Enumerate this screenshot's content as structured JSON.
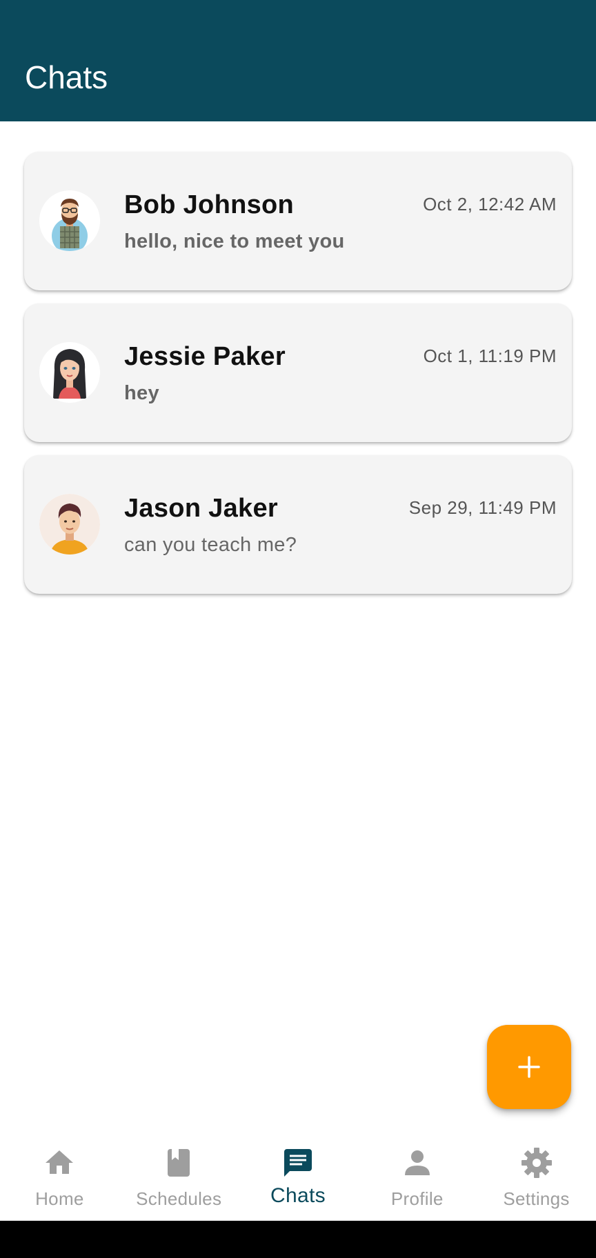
{
  "app_bar": {
    "title": "Chats"
  },
  "chats": [
    {
      "name": "Bob Johnson",
      "time": "Oct 2, 12:42 AM",
      "message": "hello, nice to meet you",
      "avatar_icon": "bearded-man-avatar"
    },
    {
      "name": "Jessie Paker",
      "time": "Oct 1, 11:19 PM",
      "message": "hey",
      "avatar_icon": "woman-avatar"
    },
    {
      "name": "Jason Jaker",
      "time": "Sep 29, 11:49 PM",
      "message": "can you teach me?",
      "avatar_icon": "young-man-avatar"
    }
  ],
  "fab": {
    "icon": "plus-icon"
  },
  "bottom_nav": {
    "items": [
      {
        "label": "Home",
        "icon": "home-icon"
      },
      {
        "label": "Schedules",
        "icon": "book-icon"
      },
      {
        "label": "Chats",
        "icon": "chat-icon"
      },
      {
        "label": "Profile",
        "icon": "person-icon"
      },
      {
        "label": "Settings",
        "icon": "gear-icon"
      }
    ],
    "active_index": 2
  },
  "colors": {
    "primary": "#0b4a5c",
    "accent": "#ff9900",
    "inactive": "#9e9e9e",
    "card": "#f4f4f4"
  }
}
